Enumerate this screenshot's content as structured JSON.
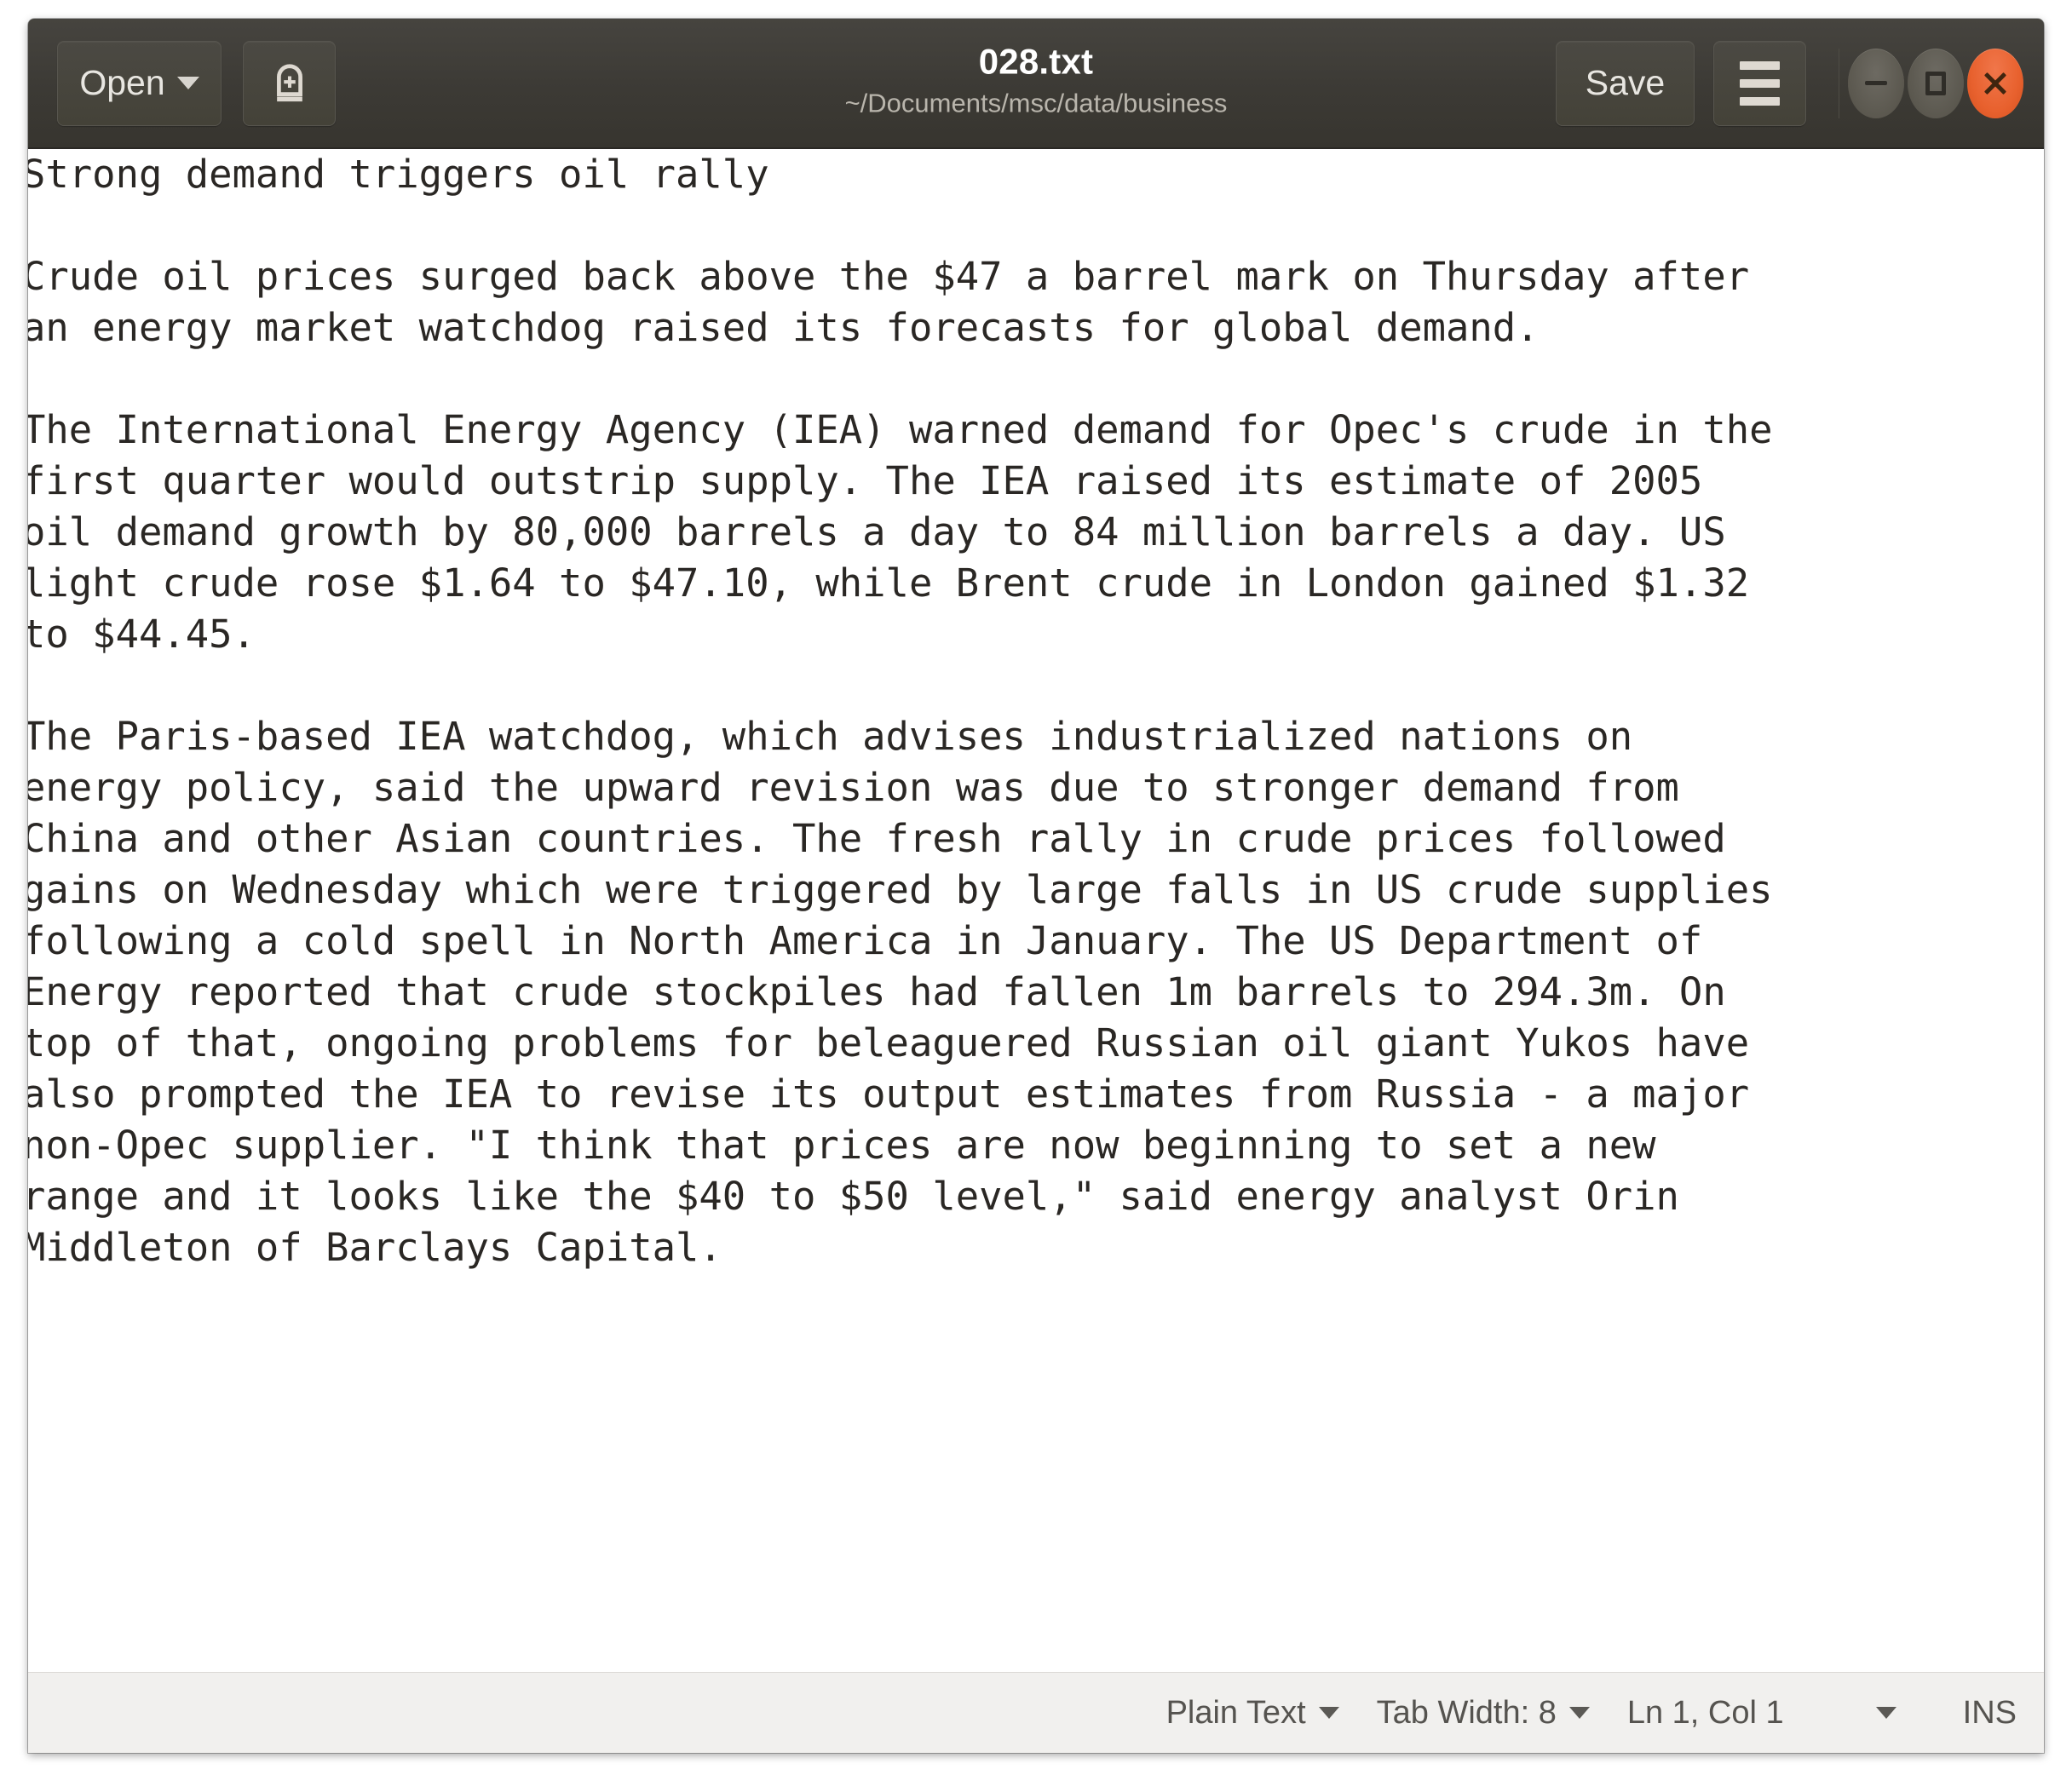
{
  "window": {
    "title": "028.txt",
    "path": "~/Documents/msc/data/business",
    "accent_close_color": "#e8612e",
    "titlebar_color": "#3c3a35",
    "statusbar_color": "#f1f0ee"
  },
  "toolbar": {
    "open_label": "Open",
    "open_caret_icon": "chevron-down-icon",
    "new_document_icon": "new-document-icon",
    "save_label": "Save",
    "menu_icon": "hamburger-menu-icon",
    "minimize_icon": "minimize-icon",
    "maximize_icon": "maximize-icon",
    "close_icon": "close-icon"
  },
  "document": {
    "body": "Strong demand triggers oil rally\n\nCrude oil prices surged back above the $47 a barrel mark on Thursday after\nan energy market watchdog raised its forecasts for global demand.\n\nThe International Energy Agency (IEA) warned demand for Opec's crude in the\nfirst quarter would outstrip supply. The IEA raised its estimate of 2005\noil demand growth by 80,000 barrels a day to 84 million barrels a day. US\nlight crude rose $1.64 to $47.10, while Brent crude in London gained $1.32\nto $44.45.\n\nThe Paris-based IEA watchdog, which advises industrialized nations on\nenergy policy, said the upward revision was due to stronger demand from\nChina and other Asian countries. The fresh rally in crude prices followed\ngains on Wednesday which were triggered by large falls in US crude supplies\nfollowing a cold spell in North America in January. The US Department of\nEnergy reported that crude stockpiles had fallen 1m barrels to 294.3m. On\ntop of that, ongoing problems for beleaguered Russian oil giant Yukos have\nalso prompted the IEA to revise its output estimates from Russia - a major\nnon-Opec supplier. \"I think that prices are now beginning to set a new\nrange and it looks like the $40 to $50 level,\" said energy analyst Orin\nMiddleton of Barclays Capital."
  },
  "statusbar": {
    "language": "Plain Text",
    "tab_width": "Tab Width: 8",
    "cursor_position": "Ln 1, Col 1",
    "insert_mode": "INS"
  }
}
